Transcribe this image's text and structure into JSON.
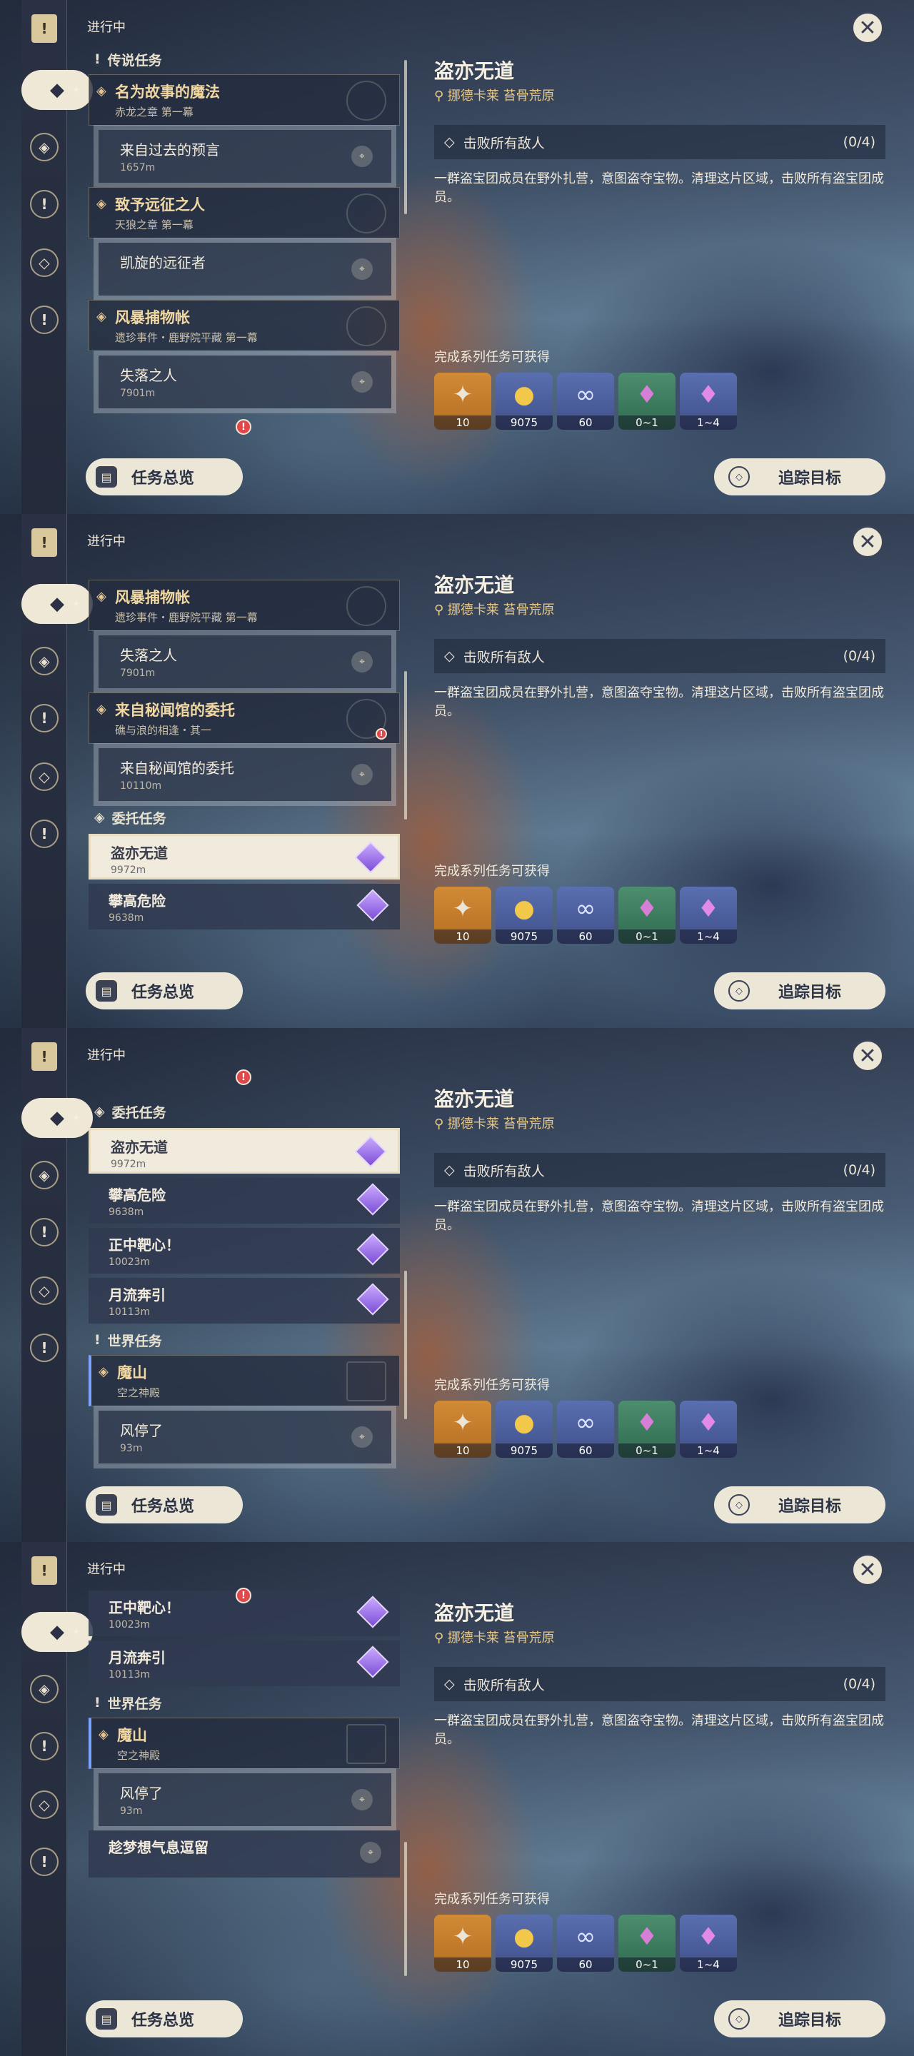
{
  "status_label": "进行中",
  "close_glyph": "✕",
  "categories": {
    "legend": "传说任务",
    "commission": "委托任务",
    "world": "世界任务"
  },
  "quests": {
    "magic": {
      "title": "名为故事的魔法",
      "subtitle": "赤龙之章 第一幕"
    },
    "prophecy": {
      "title": "来自过去的预言",
      "distance": "1657m"
    },
    "expedition": {
      "title": "致予远征之人",
      "subtitle": "天狼之章 第一幕"
    },
    "return": {
      "title": "凯旋的远征者"
    },
    "storm": {
      "title": "风暴捕物帐",
      "subtitle": "遗珍事件・鹿野院平藏 第一幕"
    },
    "lost": {
      "title": "失落之人",
      "distance": "7901m"
    },
    "secret": {
      "title": "来自秘闻馆的委托",
      "subtitle": "礁与浪的相逢・其一"
    },
    "secret_sub": {
      "title": "来自秘闻馆的委托",
      "distance": "10110m"
    },
    "thief": {
      "title": "盗亦无道",
      "distance": "9972m"
    },
    "climb": {
      "title": "攀高危险",
      "distance": "9638m"
    },
    "bullseye": {
      "title": "正中靶心！",
      "distance": "10023m"
    },
    "moon": {
      "title": "月流奔引",
      "distance": "10113m"
    },
    "demon": {
      "title": "魔山",
      "subtitle": "空之神殿"
    },
    "wind": {
      "title": "风停了",
      "distance": "93m"
    },
    "dream": {
      "title": "趁梦想气息逗留"
    }
  },
  "detail": {
    "title": "盗亦无道",
    "location": "挪德卡莱 苔骨荒原",
    "objective": "击败所有敌人",
    "objective_count": "(0/4)",
    "description": "一群盗宝团成员在野外扎营，意图盗夺宝物。清理这片区域，击败所有盗宝团成员。",
    "rewards_label": "完成系列任务可获得",
    "rewards": [
      {
        "name": "primogem-icon",
        "count": "10"
      },
      {
        "name": "mora-icon",
        "count": "9075"
      },
      {
        "name": "exp-icon",
        "count": "60"
      },
      {
        "name": "crystal-icon",
        "count": "0~1"
      },
      {
        "name": "ore-icon",
        "count": "1~4"
      }
    ]
  },
  "buttons": {
    "overview": "任务总览",
    "track": "追踪目标"
  },
  "colors": {
    "panel_cream": "#ece6d6",
    "quest_gold": "#f1d7a2",
    "location_gold": "#e8c98c",
    "alert_red": "#e0484b"
  }
}
